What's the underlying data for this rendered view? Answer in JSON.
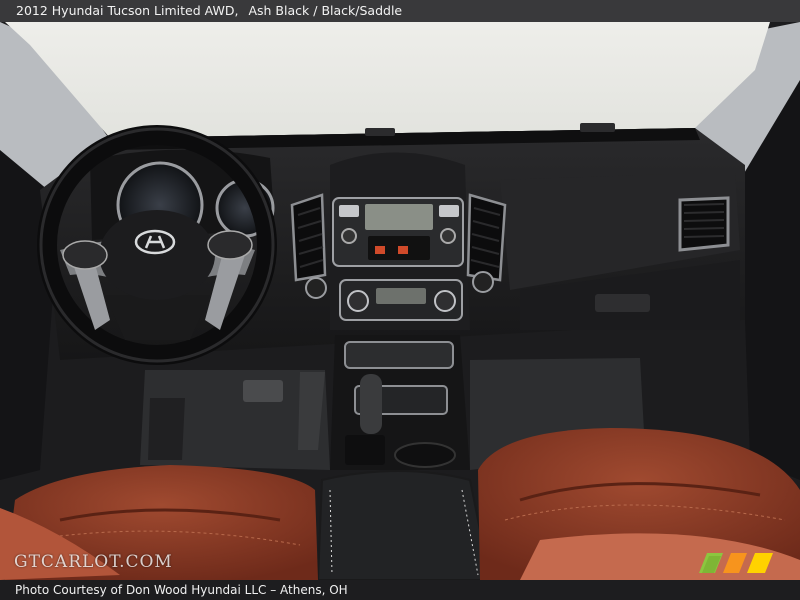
{
  "header": {
    "model": "2012 Hyundai Tucson Limited AWD,",
    "exterior_color": "Ash Black",
    "separator": "/",
    "interior_color": "Black/Saddle"
  },
  "photo": {
    "subject": "Dashboard and front seats",
    "icons": {
      "steering_wheel": "steering-wheel-icon",
      "brand_logo": "hyundai-logo-icon"
    }
  },
  "watermark": {
    "text": "GTCARLOT.COM"
  },
  "footer": {
    "credit": "Photo Courtesy of Don Wood Hyundai LLC – Athens, OH"
  },
  "colors": {
    "title_bar": "#3c3c3e",
    "seat_leather": "#8a3a26",
    "dash": "#1e1e20",
    "badge_green": "#8cc63f",
    "badge_orange": "#f7941d",
    "badge_yellow": "#ffd200"
  }
}
